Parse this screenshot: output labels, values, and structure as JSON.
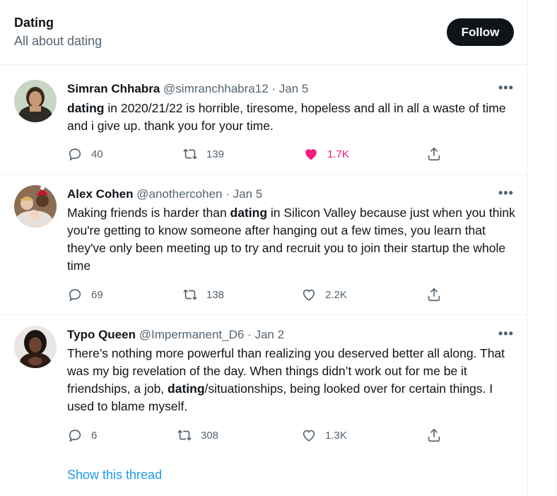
{
  "topic": {
    "title": "Dating",
    "subtitle": "All about dating",
    "follow_label": "Follow"
  },
  "tweets": [
    {
      "name": "Simran Chhabra",
      "handle": "@simranchhabra12",
      "dot": "·",
      "date": "Jan 5",
      "text_bold": "dating",
      "text_rest": " in 2020/21/22 is horrible, tiresome, hopeless and all in all a waste of time and i give up. thank you for your time.",
      "replies": "40",
      "retweets": "139",
      "likes": "1.7K",
      "liked": true
    },
    {
      "name": "Alex Cohen",
      "handle": "@anothercohen",
      "dot": "·",
      "date": "Jan 5",
      "text_before": "Making friends is harder than ",
      "text_bold": "dating",
      "text_after": " in Silicon Valley because just when you think you're getting to know someone after hanging out a few times, you learn that they've only been meeting up to try and recruit you to join their startup the whole time",
      "replies": "69",
      "retweets": "138",
      "likes": "2.2K",
      "liked": false
    },
    {
      "name": "Typo Queen",
      "handle": "@Impermanent_D6",
      "dot": "·",
      "date": "Jan 2",
      "text_before": "There’s nothing more powerful than realizing you deserved better all along. That was my big revelation of the day. When things didn’t work out for me be it friendships, a job, ",
      "text_bold": "dating",
      "text_after": "/situationships, being looked over for certain things. I used to blame myself.",
      "replies": "6",
      "retweets": "308",
      "likes": "1.3K",
      "liked": false
    }
  ],
  "more_icon": "more-dots-icon",
  "show_thread_label": "Show this thread",
  "colors": {
    "like_active": "#f91880",
    "link": "#1d9bf0",
    "muted": "#536471",
    "text": "#0f1419"
  }
}
